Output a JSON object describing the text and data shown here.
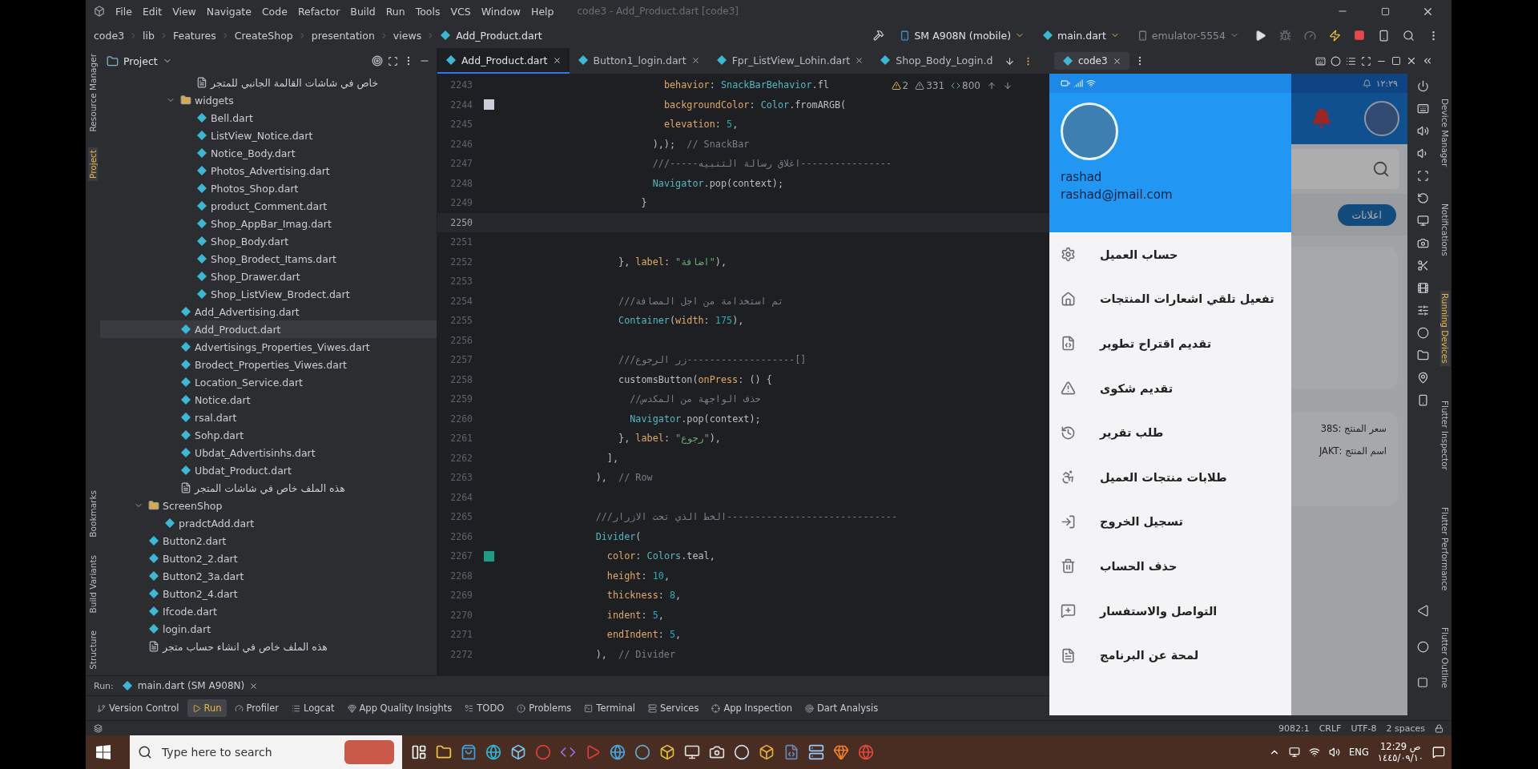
{
  "menu_bar": {
    "items": [
      "File",
      "Edit",
      "View",
      "Navigate",
      "Code",
      "Refactor",
      "Build",
      "Run",
      "Tools",
      "VCS",
      "Window",
      "Help"
    ],
    "title": "code3 - Add_Product.dart [code3]"
  },
  "breadcrumb": [
    "code3",
    "lib",
    "Features",
    "CreateShop",
    "presentation",
    "views",
    "Add_Product.dart"
  ],
  "run_toolbar": {
    "device": "SM A908N (mobile)",
    "config": "main.dart",
    "emulator": "emulator-5554"
  },
  "left_stripe": [
    {
      "label": "Resource Manager",
      "selected": false
    },
    {
      "label": "Project",
      "selected": true
    },
    {
      "label": "Bookmarks",
      "selected": false
    },
    {
      "label": "Build Variants",
      "selected": false
    },
    {
      "label": "Structure",
      "selected": false
    }
  ],
  "project_panel": {
    "title": "Project",
    "tree": [
      {
        "children": [
          {
            "children": [
              {
                "children": [
                  {
                    "label": "خاص في شاشات القالمة الجانبي للمتجر",
                    "kind": "text",
                    "selected": false
                  }
                ]
              },
              {
                "label": "widgets",
                "kind": "folder",
                "expanded": true,
                "selected": false,
                "children": [
                  {
                    "label": "Bell.dart",
                    "kind": "dart",
                    "selected": false
                  },
                  {
                    "label": "ListView_Notice.dart",
                    "kind": "dart",
                    "selected": false
                  },
                  {
                    "label": "Notice_Body.dart",
                    "kind": "dart",
                    "selected": false
                  },
                  {
                    "label": "Photos_Advertising.dart",
                    "kind": "dart",
                    "selected": false
                  },
                  {
                    "label": "Photos_Shop.dart",
                    "kind": "dart",
                    "selected": false
                  },
                  {
                    "label": "product_Comment.dart",
                    "kind": "dart",
                    "selected": false
                  },
                  {
                    "label": "Shop_AppBar_Imag.dart",
                    "kind": "dart",
                    "selected": false
                  },
                  {
                    "label": "Shop_Body.dart",
                    "kind": "dart",
                    "selected": false
                  },
                  {
                    "label": "Shop_Brodect_Itams.dart",
                    "kind": "dart",
                    "selected": false
                  },
                  {
                    "label": "Shop_Drawer.dart",
                    "kind": "dart",
                    "selected": false
                  },
                  {
                    "label": "Shop_ListView_Brodect.dart",
                    "kind": "dart",
                    "selected": false
                  }
                ]
              },
              {
                "label": "Add_Advertising.dart",
                "kind": "dart",
                "selected": false
              },
              {
                "label": "Add_Product.dart",
                "kind": "dart",
                "selected": true
              },
              {
                "label": "Advertisings_Properties_Viwes.dart",
                "kind": "dart",
                "selected": false
              },
              {
                "label": "Brodect_Properties_Viwes.dart",
                "kind": "dart",
                "selected": false
              },
              {
                "label": "Location_Service.dart",
                "kind": "dart",
                "selected": false
              },
              {
                "label": "Notice.dart",
                "kind": "dart",
                "selected": false
              },
              {
                "label": "rsal.dart",
                "kind": "dart",
                "selected": false
              },
              {
                "label": "Sohp.dart",
                "kind": "dart",
                "selected": false
              },
              {
                "label": "Ubdat_Advertisinhs.dart",
                "kind": "dart",
                "selected": false
              },
              {
                "label": "Ubdat_Product.dart",
                "kind": "dart",
                "selected": false
              },
              {
                "label": "هذه الملف خاص في شاشات المتجر",
                "kind": "text",
                "selected": false
              }
            ]
          }
        ]
      },
      {
        "label": "ScreenShop",
        "kind": "folder",
        "expanded": true,
        "selected": false,
        "children": [
          {
            "label": "pradctAdd.dart",
            "kind": "dart",
            "selected": false
          }
        ]
      },
      {
        "label": "Button2.dart",
        "kind": "dart",
        "selected": false
      },
      {
        "label": "Button2_2.dart",
        "kind": "dart",
        "selected": false
      },
      {
        "label": "Button2_3a.dart",
        "kind": "dart",
        "selected": false
      },
      {
        "label": "Button2_4.dart",
        "kind": "dart",
        "selected": false
      },
      {
        "label": "Ifcode.dart",
        "kind": "dart",
        "selected": false
      },
      {
        "label": "login.dart",
        "kind": "dart",
        "selected": false
      },
      {
        "label": "هذه الملف خاص في انشاء حساب متجر",
        "kind": "text",
        "selected": false
      }
    ]
  },
  "editor": {
    "tabs": [
      {
        "label": "Add_Product.dart",
        "selected": true,
        "closable": true
      },
      {
        "label": "Button1_login.dart",
        "selected": false,
        "closable": true
      },
      {
        "label": "Fpr_ListView_Lohin.dart",
        "selected": false,
        "closable": true
      },
      {
        "label": "Shop_Body_Login.d",
        "selected": false,
        "closable": false
      }
    ],
    "inspections": {
      "warnings": "2",
      "weak_warnings": "331",
      "typos": "800"
    },
    "lines": [
      {
        "number": "2243",
        "text": "                            behavior: SnackBarBehavior.fl",
        "current": false
      },
      {
        "number": "2244",
        "text": "                            backgroundColor: Color.fromARGB(",
        "current": false,
        "color": "#c9ced8"
      },
      {
        "number": "2245",
        "text": "                            elevation: 5,",
        "current": false
      },
      {
        "number": "2246",
        "text": "                          ),);  // SnackBar",
        "current": false
      },
      {
        "number": "2247",
        "text": "                          ///-----اغلاق رسالة التنبيه----------------",
        "current": false
      },
      {
        "number": "2248",
        "text": "                          Navigator.pop(context);",
        "current": false
      },
      {
        "number": "2249",
        "text": "                        }",
        "current": false
      },
      {
        "number": "2250",
        "current": true
      },
      {
        "number": "2251",
        "current": false
      },
      {
        "number": "2252",
        "text": "                    }, label: \"اضافة\"),",
        "current": false
      },
      {
        "number": "2253",
        "current": false
      },
      {
        "number": "2254",
        "text": "                    ///تم استخدامة من اجل المصافة",
        "current": false
      },
      {
        "number": "2255",
        "text": "                    Container(width: 175),",
        "current": false
      },
      {
        "number": "2256",
        "current": false
      },
      {
        "number": "2257",
        "text": "                    ///زر الرجوع-------------------[]",
        "current": false
      },
      {
        "number": "2258",
        "text": "                    customsButton(onPress: () {",
        "current": false
      },
      {
        "number": "2259",
        "text": "                      //حذف الواجهة من المكدس",
        "current": false
      },
      {
        "number": "2260",
        "text": "                      Navigator.pop(context);",
        "current": false
      },
      {
        "number": "2261",
        "text": "                    }, label: \"رجوع\"),",
        "current": false
      },
      {
        "number": "2262",
        "text": "                  ],",
        "current": false
      },
      {
        "number": "2263",
        "text": "                ),  // Row",
        "current": false
      },
      {
        "number": "2264",
        "current": false
      },
      {
        "number": "2265",
        "text": "                ///الخط الذي تحت الازرار------------------------------",
        "current": false
      },
      {
        "number": "2266",
        "text": "                Divider(",
        "current": false
      },
      {
        "number": "2267",
        "text": "                  color: Colors.teal,",
        "current": false,
        "color": "#1f9a84"
      },
      {
        "number": "2268",
        "text": "                  height: 10,",
        "current": false
      },
      {
        "number": "2269",
        "text": "                  thickness: 8,",
        "current": false
      },
      {
        "number": "2270",
        "text": "                  indent: 5,",
        "current": false
      },
      {
        "number": "2271",
        "text": "                  endIndent: 5,",
        "current": false
      },
      {
        "number": "2272",
        "text": "                ),  // Divider",
        "current": false
      }
    ]
  },
  "run_bar": {
    "label": "Run:",
    "tab": "main.dart (SM A908N)"
  },
  "tool_tabs": [
    {
      "label": "Version Control",
      "selected": false
    },
    {
      "label": "Run",
      "selected": true
    },
    {
      "label": "Profiler",
      "selected": false
    },
    {
      "label": "Logcat",
      "selected": false
    },
    {
      "label": "App Quality Insights",
      "selected": false
    },
    {
      "label": "TODO",
      "selected": false
    },
    {
      "label": "Problems",
      "selected": false
    },
    {
      "label": "Terminal",
      "selected": false
    },
    {
      "label": "Services",
      "selected": false
    },
    {
      "label": "App Inspection",
      "selected": false
    },
    {
      "label": "Dart Analysis",
      "selected": false
    }
  ],
  "emulator": {
    "tab": "code3",
    "right_stripe": [
      {
        "label": "Device Manager",
        "selected": false
      },
      {
        "label": "Notifications",
        "selected": false
      },
      {
        "label": "Running Devices",
        "selected": true
      },
      {
        "label": "Flutter Inspector",
        "selected": false
      },
      {
        "label": "Flutter Performance",
        "selected": false
      },
      {
        "label": "Flutter Outline",
        "selected": false
      }
    ],
    "phone": {
      "status_time": "١٢:٢٩",
      "user_name": "rashad",
      "email": "rashad@jmail.com",
      "drawer_items": [
        "حساب العميل",
        "تفعيل تلقي اشعارات المنتجات",
        "تقديم اقتراح تطوير",
        "تقديم شكوى",
        "طلب تقرير",
        "طلابات منتجات العميل",
        "تسجيل الخروج",
        "حذف الحساب",
        "التواصل والاستفسار",
        "لمحة عن البرنامج"
      ],
      "background": {
        "button": "اعلانات",
        "product_price": "سعر المنتج :38S",
        "product_name": "اسم المنتج :JAKT"
      }
    }
  },
  "status_bar": {
    "position": "9082:1",
    "line_ending": "CRLF",
    "encoding": "UTF-8",
    "indent": "2 spaces"
  },
  "taskbar": {
    "search_placeholder": "Type here to search",
    "language": "ENG",
    "time": "ص 12:29",
    "date": "١٤٤٥/٠٩/١٠"
  }
}
